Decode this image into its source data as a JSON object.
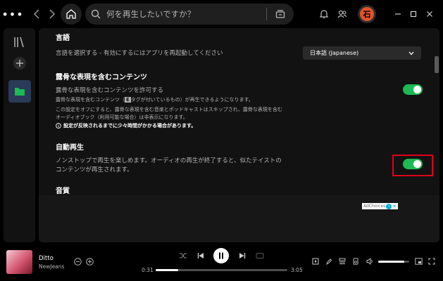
{
  "topbar": {
    "menu_label": "•••",
    "search_placeholder": "何を再生したいですか？",
    "avatar_initial": "石"
  },
  "settings": {
    "language": {
      "title": "言語",
      "description": "言語を選択する - 有効にするにはアプリを再起動してください",
      "selected": "日本語 (Japanese)"
    },
    "explicit": {
      "title": "露骨な表現を含むコンテンツ",
      "description": "露骨な表現を含むコンテンツを許可する",
      "detail_1a": "露骨な表現を含むコンテンツ（",
      "tag": "E",
      "detail_1b": "タグが付いているもの）が再生できるようになります。",
      "detail_2": "この設定をオフにすると、露骨な表現を含む音楽とポッドキャストはスキップされ、露骨な表現を含む",
      "detail_3": "オーディオブック（利用可能な場合）は非表示になります。",
      "warning": "設定が反映されるまでに少々時間がかかる場合があります。",
      "enabled": true
    },
    "autoplay": {
      "title": "自動再生",
      "description_1": "ノンストップで再生を楽しめます。オーディオの再生が終了すると、似たテイストの",
      "description_2": "コンテンツが再生されます。",
      "enabled": true
    },
    "quality": {
      "title": "音質"
    }
  },
  "ad": {
    "label": "AdChoices"
  },
  "player": {
    "track_title": "Ditto",
    "artist": "NewJeans",
    "elapsed": "0:31",
    "duration": "3:05",
    "progress": 0.17,
    "volume": 0.85
  },
  "colors": {
    "accent": "#1db954",
    "highlight_box": "#e0001b",
    "avatar": "#e0542b"
  }
}
